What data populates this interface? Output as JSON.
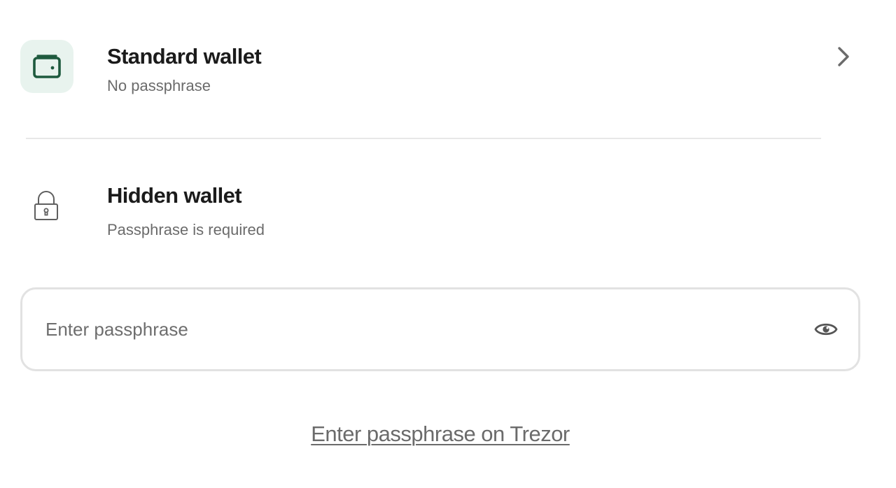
{
  "standard_wallet": {
    "title": "Standard wallet",
    "subtitle": "No passphrase",
    "icon": "wallet-icon",
    "action_icon": "chevron-right-icon"
  },
  "hidden_wallet": {
    "title": "Hidden wallet",
    "subtitle": "Passphrase is required",
    "icon": "lock-icon"
  },
  "passphrase": {
    "value": "",
    "placeholder": "Enter passphrase",
    "toggle_icon": "eye-icon"
  },
  "links": {
    "enter_on_device": "Enter passphrase on Trezor"
  },
  "colors": {
    "accent_green": "#1e5a3e",
    "icon_tile_bg": "#e8f3ee",
    "title_text": "#1b1b1b",
    "muted_text": "#6b6b6b",
    "border": "#e2e2e2"
  }
}
